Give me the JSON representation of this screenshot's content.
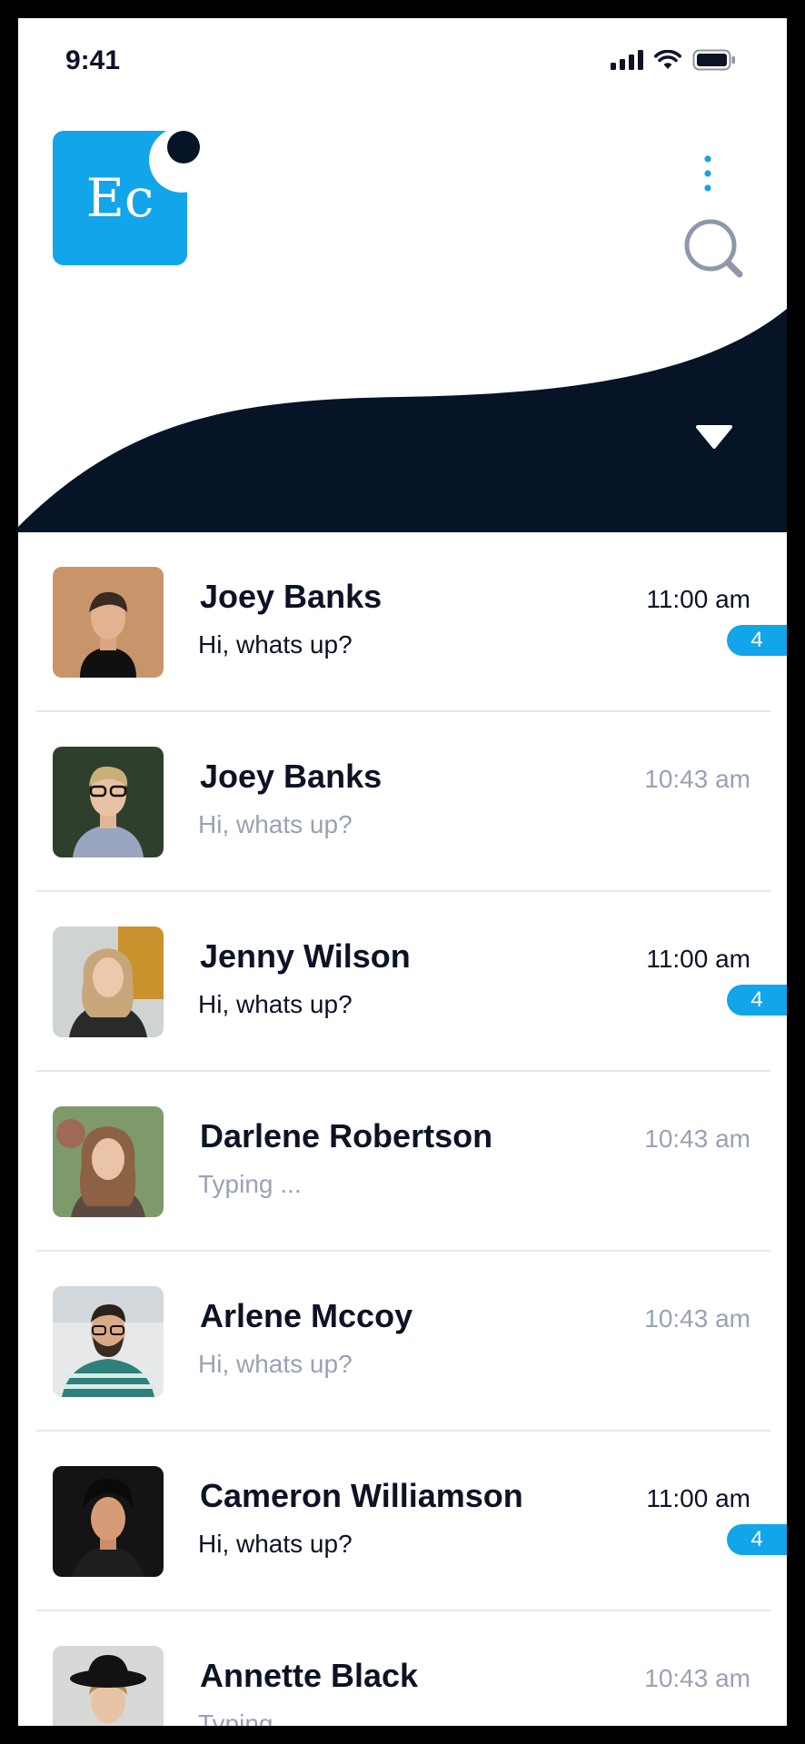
{
  "status_bar": {
    "time": "9:41"
  },
  "header": {
    "logo_text": "Ec",
    "colors": {
      "accent": "#12a5ea",
      "dark": "#071427"
    }
  },
  "icons": {
    "menu": "kebab-menu-icon",
    "search": "search-icon",
    "dropdown": "dropdown-triangle-icon"
  },
  "conversations": [
    {
      "name": "Joey Banks",
      "message": "Hi, whats up?",
      "time": "11:00 am",
      "unread": "4"
    },
    {
      "name": "Joey Banks",
      "message": "Hi, whats up?",
      "time": "10:43 am",
      "unread": null
    },
    {
      "name": "Jenny Wilson",
      "message": "Hi, whats up?",
      "time": "11:00 am",
      "unread": "4"
    },
    {
      "name": "Darlene Robertson",
      "message": "Typing ...",
      "time": "10:43 am",
      "unread": null
    },
    {
      "name": "Arlene Mccoy",
      "message": "Hi, whats up?",
      "time": "10:43 am",
      "unread": null
    },
    {
      "name": "Cameron Williamson",
      "message": "Hi, whats up?",
      "time": "11:00 am",
      "unread": "4"
    },
    {
      "name": "Annette Black",
      "message": "Typing ...",
      "time": "10:43 am",
      "unread": null
    }
  ]
}
